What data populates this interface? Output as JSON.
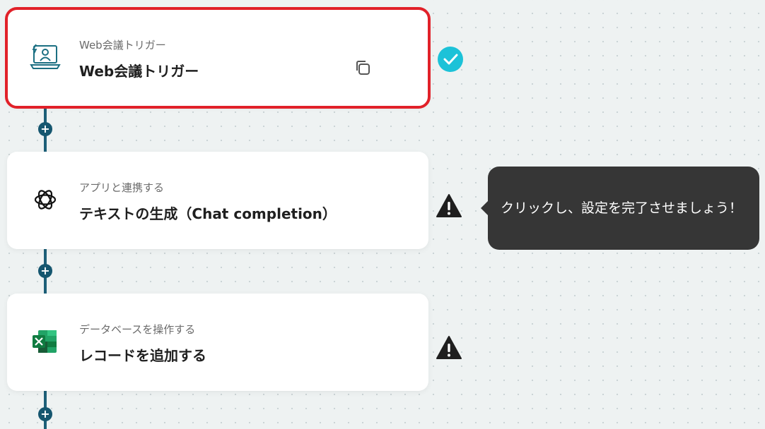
{
  "steps": [
    {
      "subtitle": "Web会議トリガー",
      "title": "Web会議トリガー",
      "status": "check-icon"
    },
    {
      "subtitle": "アプリと連携する",
      "title": "テキストの生成（Chat completion）",
      "status": "warning-icon"
    },
    {
      "subtitle": "データベースを操作する",
      "title": "レコードを追加する",
      "status": "warning-icon"
    }
  ],
  "tooltip": {
    "text": "クリックし、設定を完了させましょう！"
  },
  "add_step_label": "+",
  "colors": {
    "selected_outline": "#e12129",
    "connector": "#1d5f78",
    "check_badge": "#1cc2d8",
    "tooltip_bg": "#363636"
  }
}
